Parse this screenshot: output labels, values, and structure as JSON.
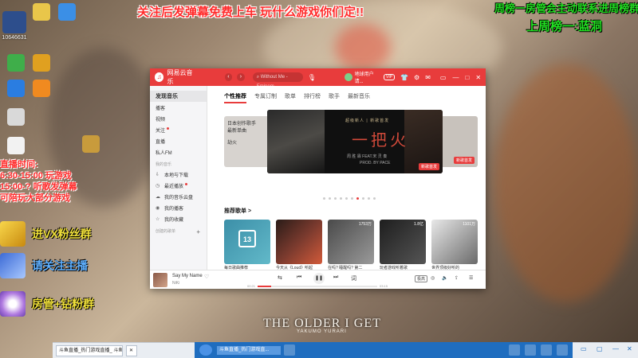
{
  "overlay": {
    "top_banner": "关注后发弹幕免费上车  玩什么游戏你们定!!",
    "right_line1": "周榜一房管会主动联系进周榜群",
    "right_line2": "上周榜一:蓝洞",
    "schedule": [
      "直播时间:",
      "6:30-15:00  玩游戏",
      "15:00-? 听歌发弹幕",
      "可陪玩大部分游戏"
    ],
    "promo": [
      "进VX粉丝群",
      "请关注主播",
      "房管+钻粉群"
    ],
    "wallpaper_caption": "THE OLDER I GET",
    "wallpaper_caption_sub": "YAKUMO YURARI"
  },
  "desktop": {
    "id_label": "10646631",
    "icons": [
      "",
      "",
      "",
      "",
      "",
      "",
      "",
      "",
      ""
    ]
  },
  "music_app": {
    "app_name": "网易云音乐",
    "search_placeholder": "Without Me - Eminem",
    "user_name": "地球用户请...",
    "vip_label": "VIP",
    "sidebar": {
      "items": [
        {
          "label": "发现音乐",
          "active": true
        },
        {
          "label": "播客"
        },
        {
          "label": "视频"
        },
        {
          "label": "关注",
          "dot": true
        },
        {
          "label": "直播"
        },
        {
          "label": "私人FM"
        }
      ],
      "my_music_header": "我的音乐",
      "my_music": [
        {
          "label": "本地与下载",
          "icon": "⇩"
        },
        {
          "label": "最近播放",
          "icon": "◷",
          "dot": true
        },
        {
          "label": "我的音乐云盘",
          "icon": "☁"
        },
        {
          "label": "我的播客",
          "icon": "◉"
        },
        {
          "label": "我的收藏",
          "icon": "☆"
        }
      ],
      "created_header": "创建的歌单"
    },
    "tabs": [
      "个性推荐",
      "专属订制",
      "歌单",
      "排行榜",
      "歌手",
      "最新音乐"
    ],
    "banner": {
      "left_text": "日本创作歌手\n最新单曲\n\n劫火",
      "header": "超级新人 | 新歌首发",
      "big_title": "一把火",
      "sub1": "周 胜 霖 FEAT.宋 灵 奏",
      "sub2": "PROD. BY PACE",
      "tag": "新歌首发",
      "right_tag": "新歌首发"
    },
    "section_title": "推荐歌单 >",
    "playlists": [
      {
        "title": "每日歌曲推荐",
        "count": "",
        "calendar_day": "13"
      },
      {
        "title": "今天从《Loud》听起\n私人雷达",
        "count": ""
      },
      {
        "title": "在吗? 睡醒吗? 第二\n天起不来的那种!",
        "count": "1753万"
      },
      {
        "title": "玩者游戏听着歌",
        "count": "1.8亿"
      },
      {
        "title": "世界顶级好听的\nhippop英文歌曲",
        "count": "1101万"
      }
    ],
    "player": {
      "song": "Say My Name",
      "artist": "NiKi",
      "time_elapsed": "00:21",
      "time_total": "03:15",
      "progress": 0.11,
      "quality": "极高",
      "lyrics_btn": "词"
    }
  },
  "taskbar": {
    "app1": "斗鱼直播_热门游戏直播_ 斗鱼...",
    "app2": "斗鱼直播_热门游戏直..."
  },
  "colors": {
    "netease_red": "#e83c3c",
    "overlay_red": "#ff2b2b",
    "overlay_green": "#22e022",
    "taskbar_blue": "#1f6dbf"
  }
}
